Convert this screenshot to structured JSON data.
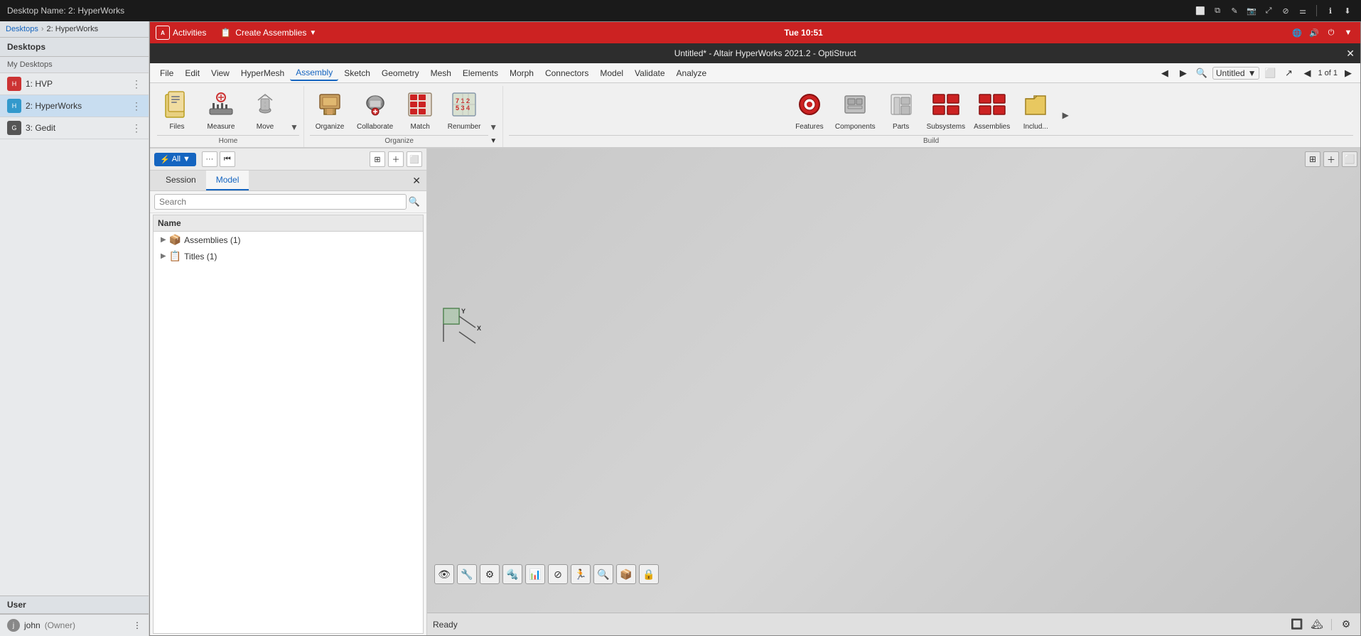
{
  "system_bar": {
    "title": "Desktop Name: 2: HyperWorks",
    "breadcrumb_root": "Desktops",
    "breadcrumb_current": "2: HyperWorks",
    "clock": "Tue 10:51"
  },
  "desktop_panel": {
    "header": "Desktops",
    "section_label": "My Desktops",
    "items": [
      {
        "id": "hvp",
        "label": "1: HVP",
        "color": "#cc3333",
        "active": false
      },
      {
        "id": "hyperworks",
        "label": "2: HyperWorks",
        "color": "#3399cc",
        "active": true
      },
      {
        "id": "gedit",
        "label": "3: Gedit",
        "color": "#333333",
        "active": false
      }
    ],
    "user_section": "User",
    "user_name": "john",
    "user_role": "(Owner)"
  },
  "app_window": {
    "title": "Untitled* - Altair HyperWorks 2021.2 - OptiStruct",
    "close_label": "✕"
  },
  "top_bar": {
    "activities_label": "Activities",
    "create_assemblies_label": "Create Assemblies",
    "clock": "Tue 10:51"
  },
  "menu_bar": {
    "items": [
      "File",
      "Edit",
      "View",
      "HyperMesh",
      "Assembly",
      "Sketch",
      "Geometry",
      "Mesh",
      "Elements",
      "Morph",
      "Connectors",
      "Model",
      "Validate",
      "Analyze"
    ],
    "active_item": "Assembly",
    "tab_name": "Untitled",
    "page_indicator": "1 of 1"
  },
  "ribbon": {
    "groups": [
      {
        "label": "Home",
        "items": [
          {
            "id": "files",
            "label": "Files",
            "icon": "📄"
          },
          {
            "id": "measure",
            "label": "Measure",
            "icon": "📏"
          },
          {
            "id": "move",
            "label": "Move",
            "icon": "🔧"
          }
        ]
      },
      {
        "label": "Organize",
        "items": [
          {
            "id": "organize",
            "label": "Organize",
            "icon": "📦"
          },
          {
            "id": "collaborate",
            "label": "Collaborate",
            "icon": "🗄"
          },
          {
            "id": "match",
            "label": "Match",
            "icon": "🔢"
          },
          {
            "id": "renumber",
            "label": "Renumber",
            "icon": "🔢"
          }
        ]
      },
      {
        "label": "Build",
        "items": [
          {
            "id": "features",
            "label": "Features",
            "icon": "⭕"
          },
          {
            "id": "components",
            "label": "Components",
            "icon": "🔩"
          },
          {
            "id": "parts",
            "label": "Parts",
            "icon": "📋"
          },
          {
            "id": "subsystems",
            "label": "Subsystems",
            "icon": "🔲"
          },
          {
            "id": "assemblies",
            "label": "Assemblies",
            "icon": "🔲"
          },
          {
            "id": "include",
            "label": "Includ...",
            "icon": "📁"
          }
        ]
      }
    ]
  },
  "left_panel": {
    "tabs": [
      "Session",
      "Model"
    ],
    "active_tab": "Model",
    "filter_btn": "⚡ All",
    "search_placeholder": "Search",
    "tree_header": "Name",
    "tree_items": [
      {
        "label": "Assemblies (1)",
        "icon": "📦",
        "type": "root"
      },
      {
        "label": "Titles (1)",
        "icon": "📋",
        "type": "root"
      }
    ]
  },
  "viewport": {
    "status": "Ready",
    "axis_y": "Y",
    "axis_x": "X"
  },
  "icons": {
    "search": "🔍",
    "close": "✕",
    "menu": "⋮",
    "chevron_down": "▼",
    "chevron_right": "▶",
    "chevron_left": "◀",
    "grid": "⊞",
    "settings": "⚙",
    "eye": "👁",
    "lock": "🔒",
    "network": "🌐",
    "volume": "🔊",
    "power": "⏻"
  }
}
